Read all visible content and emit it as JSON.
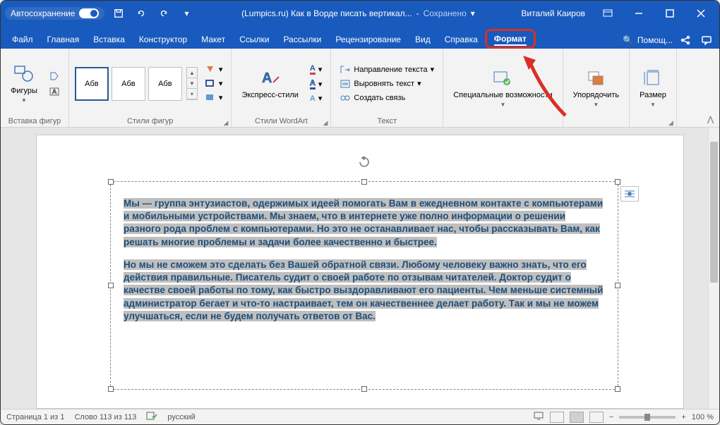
{
  "titlebar": {
    "autosave": "Автосохранение",
    "doc_title": "(Lumpics.ru) Как в Ворде писать вертикал...",
    "saved": "Сохранено",
    "user": "Виталий Каиров"
  },
  "tabs": {
    "file": "Файл",
    "home": "Главная",
    "insert": "Вставка",
    "designer": "Конструктор",
    "layout": "Макет",
    "references": "Ссылки",
    "mailings": "Рассылки",
    "review": "Рецензирование",
    "view": "Вид",
    "help": "Справка",
    "format": "Формат",
    "help_btn": "Помощ..."
  },
  "ribbon": {
    "shapes": {
      "btn": "Фигуры",
      "group": "Вставка фигур"
    },
    "styles": {
      "sample": "Абв",
      "group": "Стили фигур"
    },
    "wordart": {
      "btn": "Экспресс-стили",
      "group": "Стили WordArt"
    },
    "text": {
      "direction": "Направление текста",
      "align": "Выровнять текст",
      "link": "Создать связь",
      "group": "Текст"
    },
    "accessibility": {
      "btn": "Специальные возможности"
    },
    "arrange": {
      "btn": "Упорядочить"
    },
    "size": {
      "btn": "Размер"
    }
  },
  "body": {
    "p1": "Мы — группа энтузиастов, одержимых идеей помогать Вам в ежедневном контакте с компьютерами и мобильными устройствами. Мы знаем, что в интернете уже полно информации о решении разного рода проблем с компьютерами. Но это не останавливает нас, чтобы рассказывать Вам, как решать многие проблемы и задачи более качественно и быстрее.",
    "p2": "Но мы не сможем это сделать без Вашей обратной связи. Любому человеку важно знать, что его действия правильные. Писатель судит о своей работе по отзывам читателей. Доктор судит о качестве своей работы по тому, как быстро выздоравливают его пациенты. Чем меньше системный администратор бегает и что-то настраивает, тем он качественнее делает работу. Так и мы не можем улучшаться, если не будем получать ответов от Вас."
  },
  "status": {
    "page": "Страница 1 из 1",
    "words": "Слово 113 из 113",
    "lang": "русский",
    "zoom": "100 %"
  }
}
